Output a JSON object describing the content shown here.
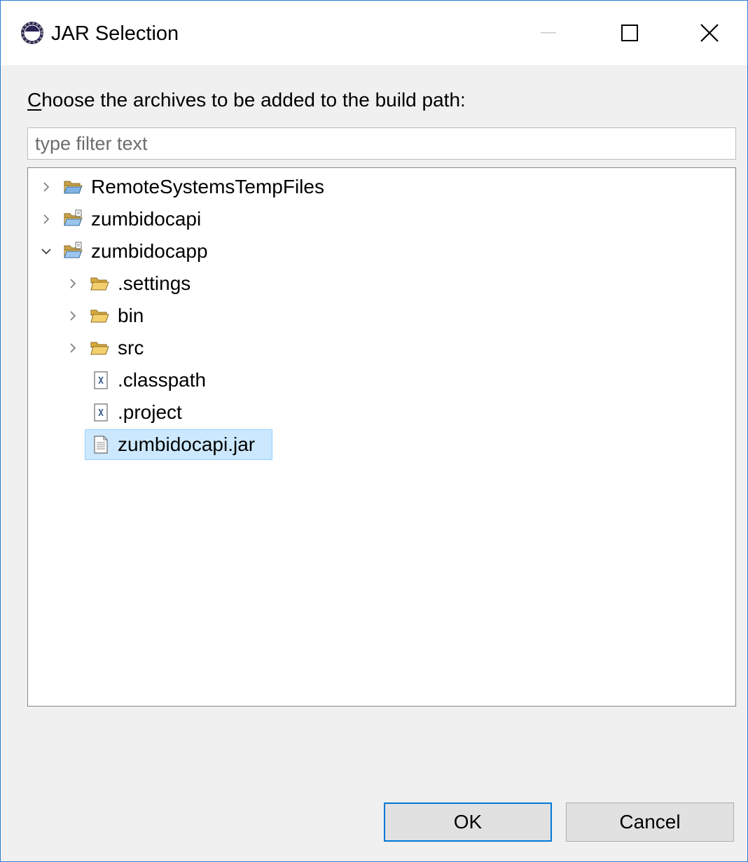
{
  "window": {
    "title": "JAR Selection",
    "controls": {
      "minimize_icon": "minimize-icon",
      "maximize_icon": "maximize-icon",
      "close_icon": "close-icon"
    }
  },
  "instruction": {
    "mnemonic": "C",
    "rest": "hoose the archives to be added to the build path:"
  },
  "filter": {
    "placeholder": "type filter text",
    "value": ""
  },
  "tree": {
    "items": [
      {
        "label": "RemoteSystemsTempFiles",
        "icon": "open-folder-icon",
        "expanded": false,
        "level": 0
      },
      {
        "label": "zumbidocapi",
        "icon": "project-folder-icon",
        "expanded": false,
        "level": 0
      },
      {
        "label": "zumbidocapp",
        "icon": "project-folder-icon",
        "expanded": true,
        "level": 0
      },
      {
        "label": ".settings",
        "icon": "folder-icon",
        "expanded": false,
        "level": 1
      },
      {
        "label": "bin",
        "icon": "folder-icon",
        "expanded": false,
        "level": 1
      },
      {
        "label": "src",
        "icon": "folder-icon",
        "expanded": false,
        "level": 1
      },
      {
        "label": ".classpath",
        "icon": "xml-file-icon",
        "level": 1
      },
      {
        "label": ".project",
        "icon": "xml-file-icon",
        "level": 1
      },
      {
        "label": "zumbidocapi.jar",
        "icon": "text-file-icon",
        "level": 1,
        "selected": true
      }
    ]
  },
  "buttons": {
    "ok": "OK",
    "cancel": "Cancel"
  },
  "colors": {
    "selection_bg": "#cce8ff",
    "selection_border": "#99d1ff",
    "default_button_border": "#0078d7",
    "folder_yellow": "#e8b84a",
    "folder_blue": "#4a90d9"
  }
}
